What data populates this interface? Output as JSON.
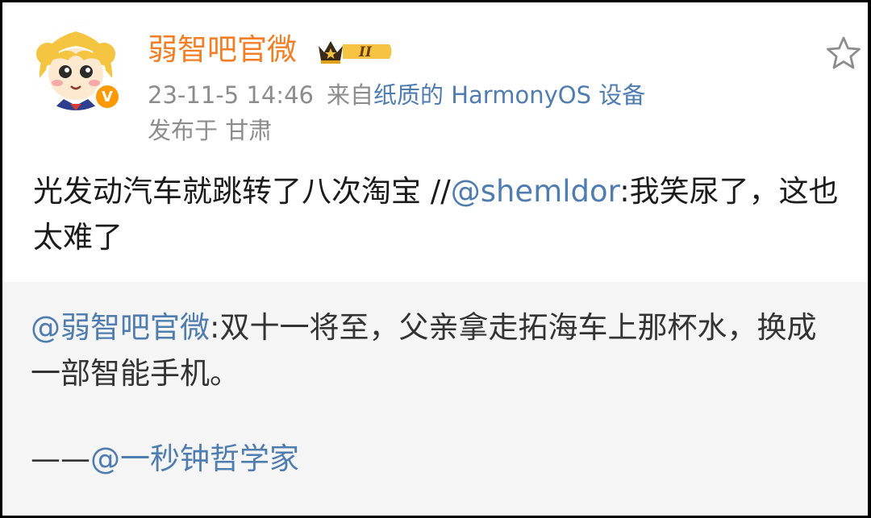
{
  "post": {
    "author": "弱智吧官微",
    "verified_badge": "V",
    "member_level": "II",
    "time": "23-11-5 14:46",
    "source_prefix": "来自",
    "source_device": "纸质的 HarmonyOS 设备",
    "location": "发布于 甘肃",
    "text_before": "光发动汽车就跳转了八次淘宝 //",
    "mention": "@shemldor",
    "text_after": ":我笑尿了，这也太难了"
  },
  "retweet": {
    "mention": "@弱智吧官微",
    "text": ":双十一将至，父亲拿走拓海车上那杯水，换成一部智能手机。",
    "credit_prefix": "——",
    "credit_mention": "@一秒钟哲学家"
  },
  "colors": {
    "author": "#f27e25",
    "link": "#4f7db0",
    "meta": "#8c8c8c",
    "retweet_bg": "#f5f5f5"
  },
  "icons": {
    "avatar": "cartoon-girl-avatar",
    "verified": "verified-v-icon",
    "member": "crown-level-badge",
    "favorite": "star-outline-icon"
  }
}
